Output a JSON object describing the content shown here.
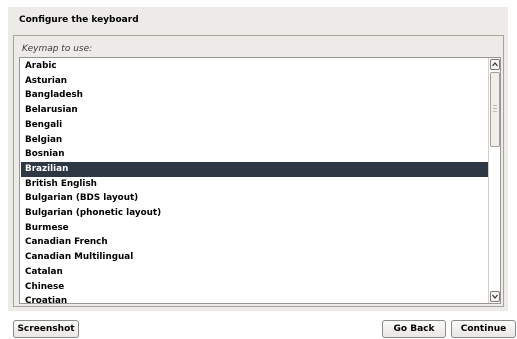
{
  "header": {
    "title": "Configure the keyboard"
  },
  "keymap": {
    "label": "Keymap to use:",
    "selected_index": 7,
    "items": [
      "Arabic",
      "Asturian",
      "Bangladesh",
      "Belarusian",
      "Bengali",
      "Belgian",
      "Bosnian",
      "Brazilian",
      "British English",
      "Bulgarian (BDS layout)",
      "Bulgarian (phonetic layout)",
      "Burmese",
      "Canadian French",
      "Canadian Multilingual",
      "Catalan",
      "Chinese",
      "Croatian"
    ]
  },
  "buttons": {
    "screenshot": "Screenshot",
    "go_back": "Go Back",
    "continue": "Continue"
  },
  "colors": {
    "selection_bg": "#2e3744",
    "panel_bg": "#edebe7"
  },
  "icons": {
    "scroll_up": "chevron-up-icon",
    "scroll_down": "chevron-down-icon"
  }
}
